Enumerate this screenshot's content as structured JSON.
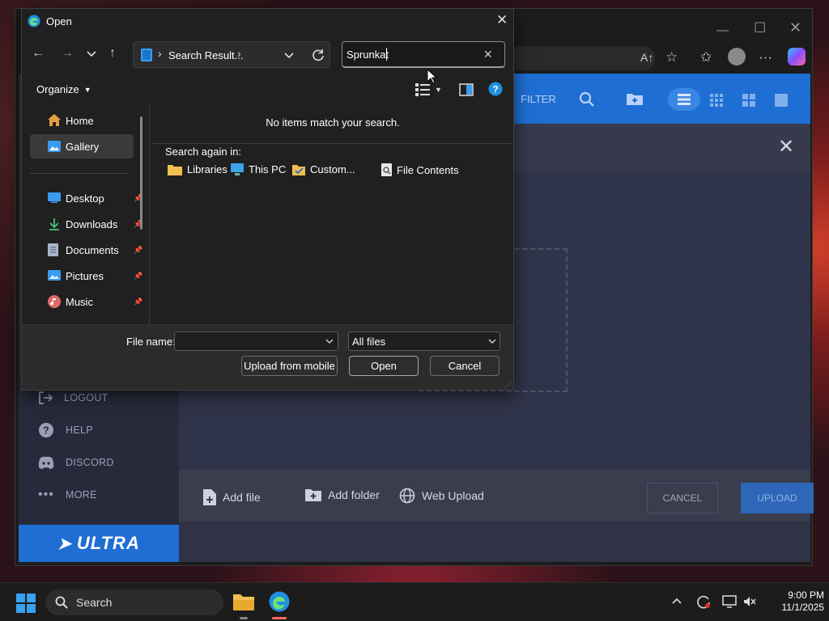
{
  "dialog": {
    "title": "Open",
    "address": {
      "breadcrumb": "Search Result...",
      "separator": "›"
    },
    "search": {
      "value": "Sprunkat"
    },
    "organize_label": "Organize",
    "nav_items": [
      {
        "label": "Home",
        "icon": "home-icon"
      },
      {
        "label": "Gallery",
        "icon": "gallery-icon",
        "selected": true
      },
      {
        "label": "Desktop",
        "icon": "desktop-icon",
        "pinned": true
      },
      {
        "label": "Downloads",
        "icon": "download-icon",
        "pinned": true
      },
      {
        "label": "Documents",
        "icon": "documents-icon",
        "pinned": true
      },
      {
        "label": "Pictures",
        "icon": "pictures-icon",
        "pinned": true
      },
      {
        "label": "Music",
        "icon": "music-icon",
        "pinned": true
      }
    ],
    "empty_message": "No items match your search.",
    "search_again_label": "Search again in:",
    "search_again": [
      "Libraries",
      "This PC",
      "Custom...",
      "File Contents"
    ],
    "file_name_label": "File name:",
    "file_name_value": "",
    "file_type": "All files",
    "upload_mobile_label": "Upload from mobile",
    "open_label": "Open",
    "cancel_label": "Cancel"
  },
  "app": {
    "toolbar": {
      "filter_label": "FILTER"
    },
    "sidebar": [
      {
        "label": "LOGOUT",
        "icon": "logout-icon"
      },
      {
        "label": "HELP",
        "icon": "help-icon"
      },
      {
        "label": "DISCORD",
        "icon": "discord-icon"
      },
      {
        "label": "MORE",
        "icon": "more-icon"
      }
    ],
    "brand": "ULTRA",
    "bottom": {
      "add_file": "Add file",
      "add_folder": "Add folder",
      "web_upload": "Web Upload",
      "cancel": "CANCEL",
      "upload": "UPLOAD"
    }
  },
  "taskbar": {
    "search_label": "Search",
    "time": "9:00 PM",
    "date": "11/1/2025"
  },
  "colors": {
    "accent": "#1f6ed4",
    "dialog_bg": "#202020"
  }
}
